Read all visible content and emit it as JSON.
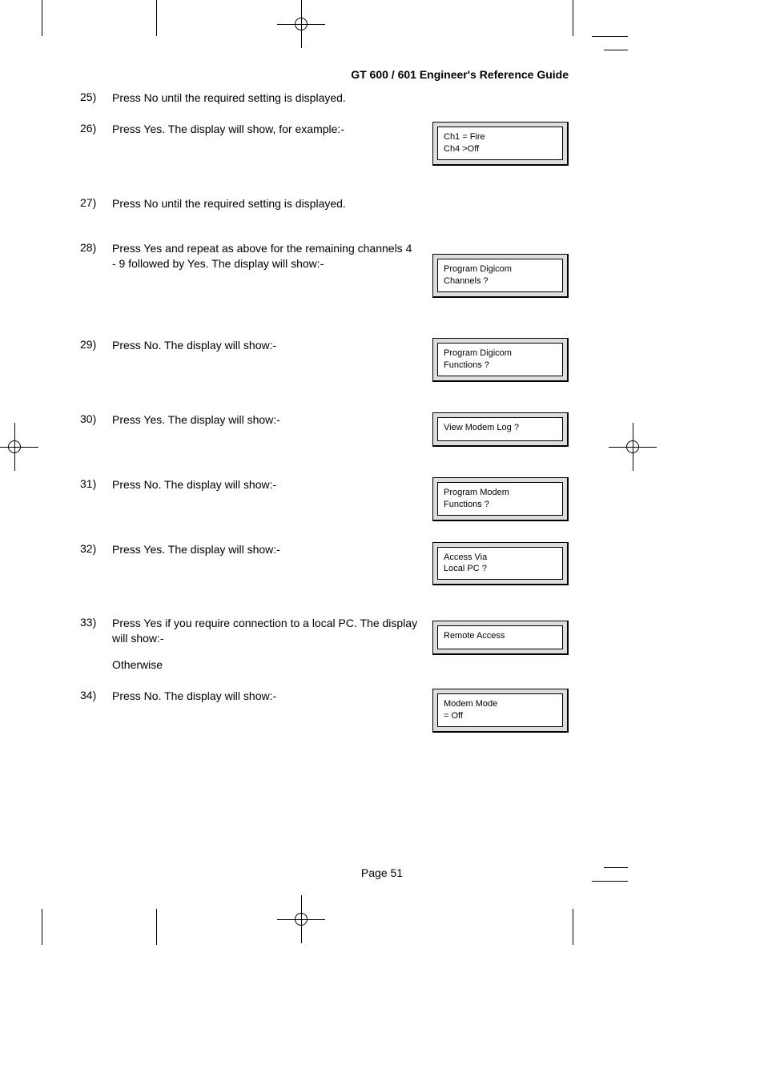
{
  "header": {
    "title": "GT 600 / 601 Engineer's Reference Guide"
  },
  "page_label": "Page  51",
  "steps": [
    {
      "num": "25)",
      "text": "Press No until the required setting is displayed.",
      "lcd": null
    },
    {
      "num": "26)",
      "text": "Press Yes. The display will show, for example:-",
      "lcd": {
        "line1": "Ch1 = Fire",
        "line2": "Ch4 >Off"
      }
    },
    {
      "num": "27)",
      "text": "Press No until the required setting is displayed.",
      "lcd": null
    },
    {
      "num": "28)",
      "text": "Press Yes and repeat as above for the remaining channels 4 - 9 followed by Yes. The display will show:-",
      "lcd": {
        "line1": "Program  Digicom",
        "line2": "Channels  ?"
      }
    },
    {
      "num": "29)",
      "text": "Press No. The display will show:-",
      "lcd": {
        "line1": "Program Digicom",
        "line2": "Functions ?"
      }
    },
    {
      "num": "30)",
      "text": "Press Yes. The display will show:-",
      "lcd": {
        "line1": "View Modem Log ?",
        "line2": ""
      }
    },
    {
      "num": "31)",
      "text": "Press No. The display will show:-",
      "lcd": {
        "line1": "Program Modem",
        "line2": "Functions ?"
      }
    },
    {
      "num": "32)",
      "text": "Press Yes. The display will show:-",
      "lcd": {
        "line1": "Access  Via",
        "line2": "Local  PC  ?"
      }
    },
    {
      "num": "33)",
      "text": "Press Yes if you require connection to a local PC. The display will show:-",
      "otherwise": "Otherwise",
      "lcd": {
        "line1": "Remote Access",
        "line2": ""
      }
    },
    {
      "num": "34)",
      "text": "Press No. The display will show:-",
      "lcd": {
        "line1": "Modem Mode",
        "line2": "= Off"
      }
    }
  ]
}
